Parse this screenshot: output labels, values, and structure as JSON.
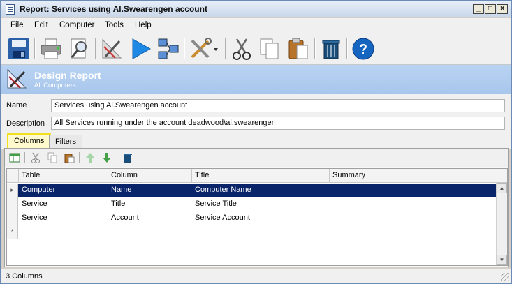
{
  "window": {
    "title": "Report: Services using Al.Swearengen account",
    "controls": {
      "minimize": "_",
      "maximize": "□",
      "close": "×"
    }
  },
  "menu": [
    "File",
    "Edit",
    "Computer",
    "Tools",
    "Help"
  ],
  "toolbar": {
    "icons": [
      "save-icon",
      "print-icon",
      "print-preview-icon",
      "design-icon",
      "run-icon",
      "network-icon",
      "tools-icon",
      "cut-icon",
      "copy-icon",
      "paste-icon",
      "delete-icon",
      "help-icon"
    ]
  },
  "header": {
    "title": "Design Report",
    "subtitle": "All Computers"
  },
  "form": {
    "name_label": "Name",
    "name_value": "Services using Al.Swearengen account",
    "description_label": "Description",
    "description_value": "All Services running under the account deadwood\\al.swearengen"
  },
  "tabs": [
    {
      "label": "Columns",
      "active": true
    },
    {
      "label": "Filters",
      "active": false
    }
  ],
  "grid": {
    "columns": [
      "Table",
      "Column",
      "Title",
      "Summary"
    ],
    "rows": [
      {
        "table": "Computer",
        "column": "Name",
        "title": "Computer Name",
        "summary": "",
        "selected": true
      },
      {
        "table": "Service",
        "column": "Title",
        "title": "Service Title",
        "summary": "",
        "selected": false
      },
      {
        "table": "Service",
        "column": "Account",
        "title": "Service Account",
        "summary": "",
        "selected": false
      }
    ],
    "new_row_marker": "*",
    "current_row_marker": "▸"
  },
  "status": {
    "text": "3 Columns"
  },
  "colors": {
    "selected_row": "#0a246a",
    "header_band": "#b9d3f2",
    "active_tab_highlight": "#f0e020"
  }
}
